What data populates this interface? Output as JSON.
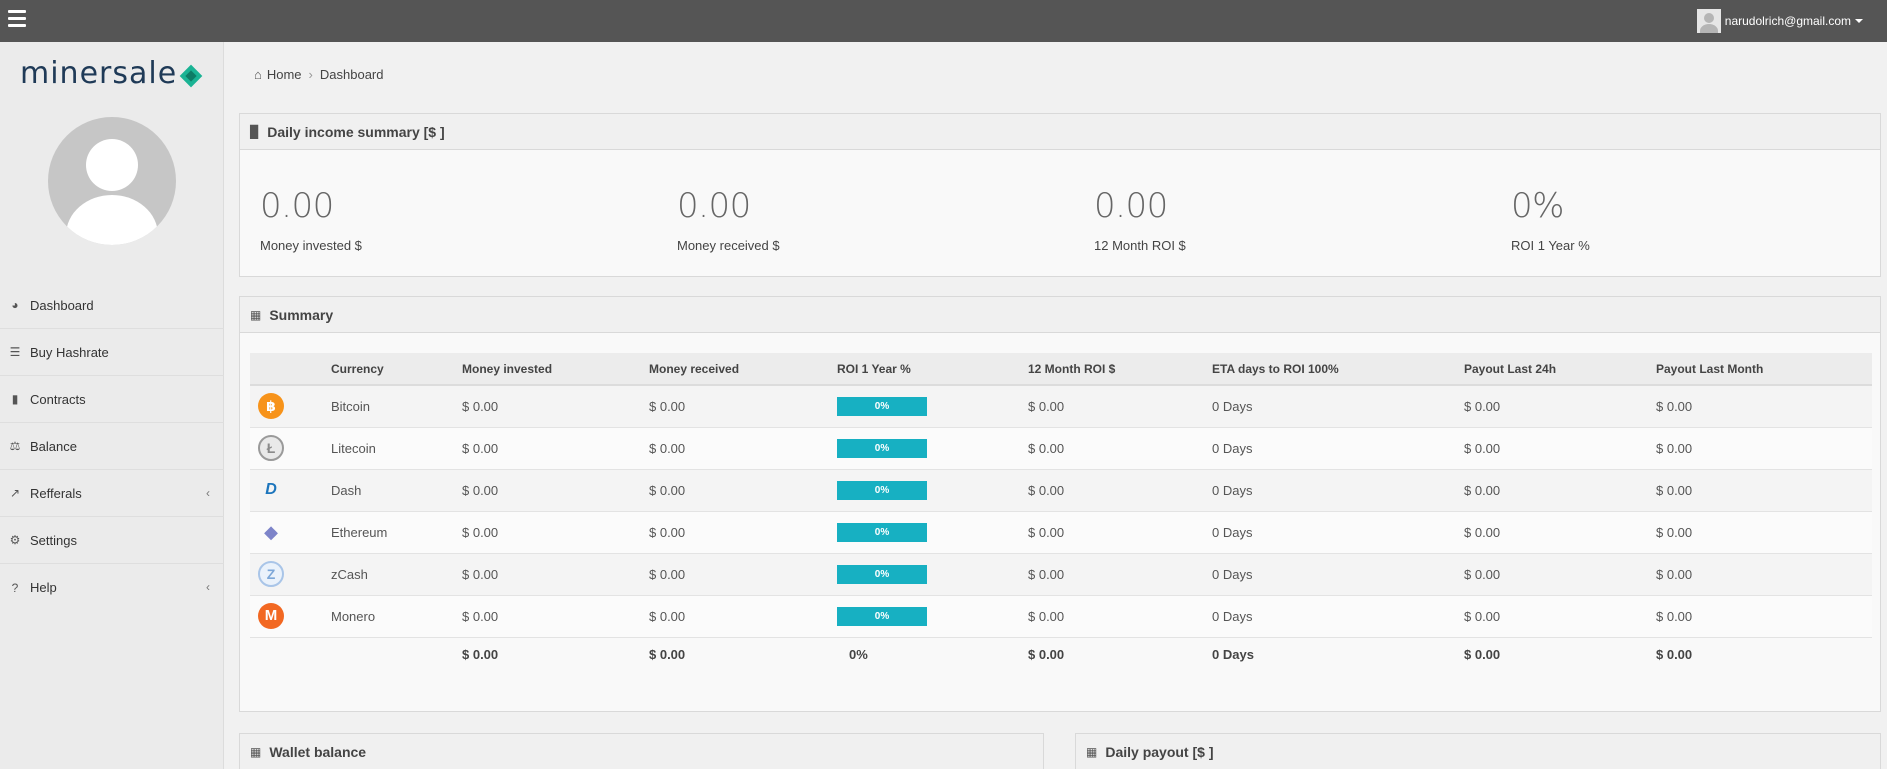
{
  "topbar": {
    "user_email": "narudolrich@gmail.com"
  },
  "sidebar": {
    "logo_text": "minersale",
    "items": [
      {
        "label": "Dashboard",
        "icon": "dashboard-icon"
      },
      {
        "label": "Buy Hashrate",
        "icon": "list-icon"
      },
      {
        "label": "Contracts",
        "icon": "file-icon"
      },
      {
        "label": "Balance",
        "icon": "scale-icon"
      },
      {
        "label": "Refferals",
        "icon": "external-link-icon"
      },
      {
        "label": "Settings",
        "icon": "gears-icon"
      },
      {
        "label": "Help",
        "icon": "question-icon"
      }
    ]
  },
  "breadcrumb": {
    "home": "Home",
    "current": "Dashboard"
  },
  "income": {
    "title": "Daily income summary [$ ]",
    "stats": [
      {
        "value": "0.00",
        "label": "Money invested $"
      },
      {
        "value": "0.00",
        "label": "Money received $"
      },
      {
        "value": "0.00",
        "label": "12 Month ROI $"
      },
      {
        "value": "0%",
        "label": "ROI 1 Year %"
      }
    ]
  },
  "summary": {
    "title": "Summary",
    "columns": [
      "Currency",
      "Money invested",
      "Money received",
      "ROI 1 Year %",
      "12 Month ROI $",
      "ETA days to ROI 100%",
      "Payout Last 24h",
      "Payout Last Month"
    ],
    "rows": [
      {
        "currency": "Bitcoin",
        "invested": "$ 0.00",
        "received": "$ 0.00",
        "roi": "0%",
        "month_roi": "$ 0.00",
        "eta": "0 Days",
        "payout_24h": "$ 0.00",
        "payout_month": "$ 0.00"
      },
      {
        "currency": "Litecoin",
        "invested": "$ 0.00",
        "received": "$ 0.00",
        "roi": "0%",
        "month_roi": "$ 0.00",
        "eta": "0 Days",
        "payout_24h": "$ 0.00",
        "payout_month": "$ 0.00"
      },
      {
        "currency": "Dash",
        "invested": "$ 0.00",
        "received": "$ 0.00",
        "roi": "0%",
        "month_roi": "$ 0.00",
        "eta": "0 Days",
        "payout_24h": "$ 0.00",
        "payout_month": "$ 0.00"
      },
      {
        "currency": "Ethereum",
        "invested": "$ 0.00",
        "received": "$ 0.00",
        "roi": "0%",
        "month_roi": "$ 0.00",
        "eta": "0 Days",
        "payout_24h": "$ 0.00",
        "payout_month": "$ 0.00"
      },
      {
        "currency": "zCash",
        "invested": "$ 0.00",
        "received": "$ 0.00",
        "roi": "0%",
        "month_roi": "$ 0.00",
        "eta": "0 Days",
        "payout_24h": "$ 0.00",
        "payout_month": "$ 0.00"
      },
      {
        "currency": "Monero",
        "invested": "$ 0.00",
        "received": "$ 0.00",
        "roi": "0%",
        "month_roi": "$ 0.00",
        "eta": "0 Days",
        "payout_24h": "$ 0.00",
        "payout_month": "$ 0.00"
      }
    ],
    "total": {
      "invested": "$ 0.00",
      "received": "$ 0.00",
      "roi": "0%",
      "month_roi": "$ 0.00",
      "eta": "0 Days",
      "payout_24h": "$ 0.00",
      "payout_month": "$ 0.00"
    }
  },
  "wallet": {
    "title": "Wallet balance"
  },
  "daily_payout": {
    "title": "Daily payout [$ ]"
  },
  "colors": {
    "accent": "#17b0c2",
    "topbar": "#555555"
  }
}
